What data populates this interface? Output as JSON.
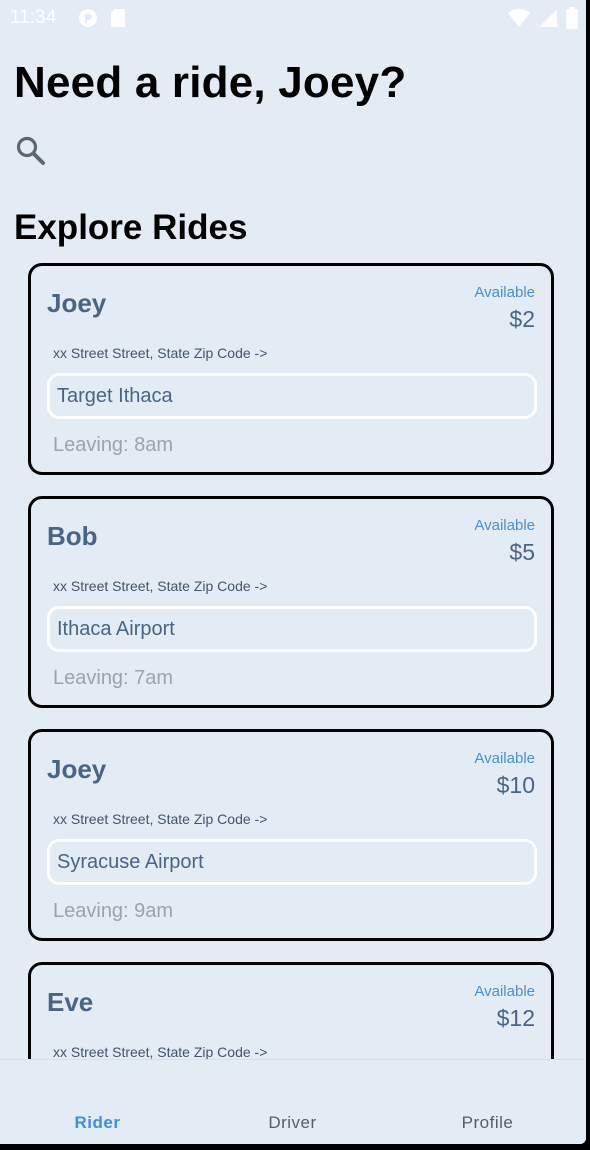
{
  "status": {
    "time": "11:34"
  },
  "header": {
    "title": "Need a ride, Joey?"
  },
  "explore": {
    "title": "Explore Rides"
  },
  "rides": [
    {
      "driver": "Joey",
      "status": "Available",
      "price": "$2",
      "street": "xx Street Street, State Zip Code ->",
      "destination": "Target Ithaca",
      "leaving": "Leaving: 8am"
    },
    {
      "driver": "Bob",
      "status": "Available",
      "price": "$5",
      "street": "xx Street Street, State Zip Code ->",
      "destination": "Ithaca Airport",
      "leaving": "Leaving: 7am"
    },
    {
      "driver": "Joey",
      "status": "Available",
      "price": "$10",
      "street": "xx Street Street, State Zip Code ->",
      "destination": "Syracuse Airport",
      "leaving": "Leaving: 9am"
    },
    {
      "driver": "Eve",
      "status": "Available",
      "price": "$12",
      "street": "xx Street Street, State Zip Code ->",
      "destination": "",
      "leaving": ""
    }
  ],
  "tabs": [
    {
      "label": "Rider",
      "active": true
    },
    {
      "label": "Driver",
      "active": false
    },
    {
      "label": "Profile",
      "active": false
    }
  ],
  "colors": {
    "background": "#e3ebf5",
    "accent": "#3d8fe0",
    "driver_name": "#4a6485",
    "available": "#4a8fd3"
  },
  "icons": [
    "signal-app-icon",
    "sd-card-icon",
    "wifi-icon",
    "cellular-signal-icon",
    "battery-icon",
    "search-icon"
  ]
}
